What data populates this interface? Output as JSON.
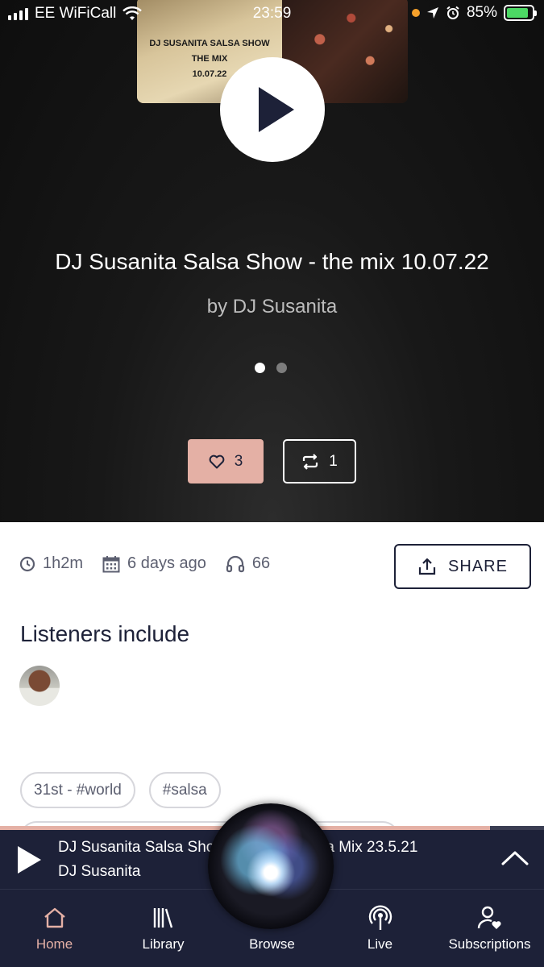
{
  "status_bar": {
    "carrier": "EE WiFiCall",
    "time": "23:59",
    "battery": "85%",
    "battery_level": 0.85
  },
  "artwork": {
    "line1": "DJ SUSANITA SALSA SHOW",
    "line2": "THE MIX",
    "line3": "10.07.22"
  },
  "show": {
    "title": "DJ Susanita Salsa Show - the mix 10.07.22",
    "author": "by DJ Susanita",
    "likes": "3",
    "reposts": "1",
    "carousel_pages": 2,
    "carousel_active": 0
  },
  "meta": {
    "duration": "1h2m",
    "uploaded": "6 days ago",
    "plays": "66"
  },
  "share_label": "SHARE",
  "listeners_heading": "Listeners include",
  "tags": [
    "31st - #world",
    "#salsa"
  ],
  "mini_player": {
    "title": "DJ Susanita Salsa Sho",
    "title_tail": "a Mix 23.5.21",
    "artist": "DJ Susanita",
    "progress": 0.9
  },
  "tabs": [
    {
      "label": "Home",
      "icon": "home-icon",
      "active": true
    },
    {
      "label": "Library",
      "icon": "library-icon",
      "active": false
    },
    {
      "label": "Browse",
      "icon": "browse-icon",
      "active": false
    },
    {
      "label": "Live",
      "icon": "live-icon",
      "active": false
    },
    {
      "label": "Subscriptions",
      "icon": "subscriptions-icon",
      "active": false
    }
  ],
  "colors": {
    "navy": "#1d2138",
    "accent_pink": "#e4b0a5",
    "muted_text": "#5c5f70"
  }
}
